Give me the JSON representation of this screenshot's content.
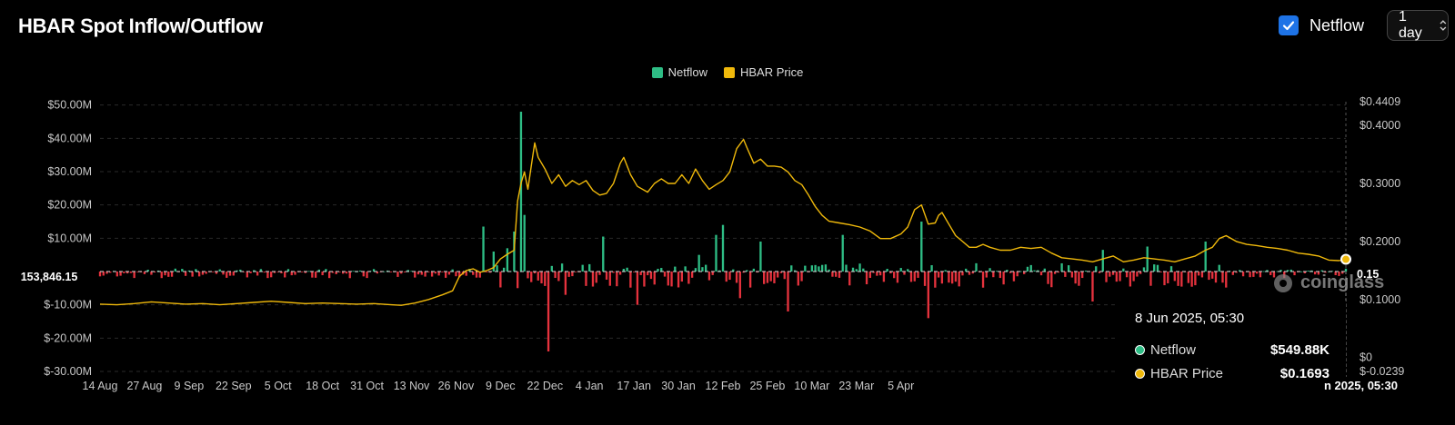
{
  "header": {
    "title": "HBAR Spot Inflow/Outflow",
    "netflow_toggle_label": "Netflow",
    "interval_value": "1 day"
  },
  "legend": [
    {
      "label": "Netflow",
      "color": "#2ebd85"
    },
    {
      "label": "HBAR Price",
      "color": "#f0b90b"
    }
  ],
  "crosshair": {
    "left_value": "153,846.15",
    "right_value": "0.15"
  },
  "watermark": "coinglass",
  "tooltip": {
    "date": "8 Jun 2025, 05:30",
    "rows": [
      {
        "name": "Netflow",
        "value": "$549.88K",
        "color": "#2ebd85"
      },
      {
        "name": "HBAR Price",
        "value": "$0.1693",
        "color": "#f0b90b"
      }
    ]
  },
  "bottom_time_label": "n 2025, 05:30",
  "colors": {
    "positive": "#2ebd85",
    "negative": "#e5323d",
    "price": "#f0b90b",
    "grid": "#2a2a2a",
    "axis_text": "#c8c8c8"
  },
  "chart_data": {
    "type": "bar",
    "title": "HBAR Spot Inflow/Outflow",
    "x_labels": [
      "14 Aug",
      "27 Aug",
      "9 Sep",
      "22 Sep",
      "5 Oct",
      "18 Oct",
      "31 Oct",
      "13 Nov",
      "26 Nov",
      "9 Dec",
      "22 Dec",
      "4 Jan",
      "17 Jan",
      "30 Jan",
      "12 Feb",
      "25 Feb",
      "10 Mar",
      "23 Mar",
      "5 Apr"
    ],
    "left_axis": {
      "ticks": [
        "$50.00M",
        "$40.00M",
        "$30.00M",
        "$20.00M",
        "$10.00M",
        "$-10.00M",
        "$-20.00M",
        "$-30.00M"
      ],
      "tick_values": [
        50,
        40,
        30,
        20,
        10,
        -10,
        -20,
        -30
      ],
      "unit": "$M",
      "ylim": [
        -30,
        51
      ]
    },
    "right_axis": {
      "ticks": [
        "$0.4409",
        "$0.4000",
        "$0.3000",
        "$0.2000",
        "$0.1000",
        "$0",
        "$-0.0239"
      ],
      "tick_values": [
        0.4409,
        0.4,
        0.3,
        0.2,
        0.1,
        0,
        -0.0239
      ],
      "ylim": [
        -0.0239,
        0.4409
      ]
    },
    "netflow_spikes": [
      {
        "day": 112,
        "value": 13.5
      },
      {
        "day": 115,
        "value": 6
      },
      {
        "day": 119,
        "value": 7
      },
      {
        "day": 121,
        "value": 12
      },
      {
        "day": 123,
        "value": 48
      },
      {
        "day": 124,
        "value": 17
      },
      {
        "day": 131,
        "value": -24
      },
      {
        "day": 136,
        "value": -7
      },
      {
        "day": 147,
        "value": 10.5
      },
      {
        "day": 157,
        "value": -10
      },
      {
        "day": 175,
        "value": 5
      },
      {
        "day": 180,
        "value": 11
      },
      {
        "day": 182,
        "value": 14
      },
      {
        "day": 187,
        "value": -8
      },
      {
        "day": 193,
        "value": 9
      },
      {
        "day": 201,
        "value": -12
      },
      {
        "day": 217,
        "value": 11
      },
      {
        "day": 240,
        "value": 15
      },
      {
        "day": 242,
        "value": -14
      },
      {
        "day": 290,
        "value": -9
      },
      {
        "day": 293,
        "value": 6.5
      },
      {
        "day": 306,
        "value": 7.5
      },
      {
        "day": 323,
        "value": 9
      }
    ],
    "series": [
      {
        "name": "Netflow",
        "axis": "left",
        "baseline_daily_range": [
          -2,
          1
        ],
        "points_shown": "daily"
      },
      {
        "name": "HBAR Price",
        "axis": "right",
        "points": [
          [
            0,
            0.092
          ],
          [
            5,
            0.091
          ],
          [
            10,
            0.093
          ],
          [
            15,
            0.096
          ],
          [
            20,
            0.094
          ],
          [
            25,
            0.092
          ],
          [
            30,
            0.093
          ],
          [
            35,
            0.091
          ],
          [
            40,
            0.093
          ],
          [
            45,
            0.095
          ],
          [
            50,
            0.097
          ],
          [
            55,
            0.095
          ],
          [
            60,
            0.093
          ],
          [
            65,
            0.094
          ],
          [
            70,
            0.093
          ],
          [
            75,
            0.092
          ],
          [
            80,
            0.093
          ],
          [
            85,
            0.091
          ],
          [
            88,
            0.09
          ],
          [
            92,
            0.094
          ],
          [
            96,
            0.1
          ],
          [
            100,
            0.108
          ],
          [
            103,
            0.115
          ],
          [
            105,
            0.14
          ],
          [
            107,
            0.15
          ],
          [
            109,
            0.153
          ],
          [
            111,
            0.147
          ],
          [
            113,
            0.15
          ],
          [
            115,
            0.155
          ],
          [
            117,
            0.17
          ],
          [
            119,
            0.178
          ],
          [
            121,
            0.185
          ],
          [
            122,
            0.27
          ],
          [
            123,
            0.3
          ],
          [
            124,
            0.32
          ],
          [
            125,
            0.29
          ],
          [
            126,
            0.33
          ],
          [
            127,
            0.37
          ],
          [
            128,
            0.345
          ],
          [
            130,
            0.325
          ],
          [
            132,
            0.3
          ],
          [
            134,
            0.315
          ],
          [
            136,
            0.295
          ],
          [
            138,
            0.305
          ],
          [
            140,
            0.298
          ],
          [
            142,
            0.305
          ],
          [
            144,
            0.288
          ],
          [
            146,
            0.28
          ],
          [
            148,
            0.283
          ],
          [
            150,
            0.3
          ],
          [
            152,
            0.335
          ],
          [
            153,
            0.345
          ],
          [
            155,
            0.315
          ],
          [
            157,
            0.295
          ],
          [
            160,
            0.285
          ],
          [
            162,
            0.3
          ],
          [
            164,
            0.308
          ],
          [
            166,
            0.3
          ],
          [
            168,
            0.3
          ],
          [
            170,
            0.315
          ],
          [
            172,
            0.3
          ],
          [
            174,
            0.325
          ],
          [
            176,
            0.305
          ],
          [
            178,
            0.29
          ],
          [
            180,
            0.298
          ],
          [
            182,
            0.305
          ],
          [
            184,
            0.32
          ],
          [
            186,
            0.36
          ],
          [
            188,
            0.376
          ],
          [
            189,
            0.362
          ],
          [
            191,
            0.335
          ],
          [
            193,
            0.342
          ],
          [
            195,
            0.33
          ],
          [
            197,
            0.33
          ],
          [
            199,
            0.328
          ],
          [
            201,
            0.32
          ],
          [
            203,
            0.305
          ],
          [
            205,
            0.298
          ],
          [
            207,
            0.28
          ],
          [
            209,
            0.26
          ],
          [
            211,
            0.245
          ],
          [
            213,
            0.235
          ],
          [
            216,
            0.232
          ],
          [
            219,
            0.229
          ],
          [
            222,
            0.225
          ],
          [
            225,
            0.218
          ],
          [
            228,
            0.205
          ],
          [
            231,
            0.205
          ],
          [
            234,
            0.213
          ],
          [
            236,
            0.225
          ],
          [
            238,
            0.255
          ],
          [
            240,
            0.263
          ],
          [
            242,
            0.23
          ],
          [
            244,
            0.232
          ],
          [
            245,
            0.245
          ],
          [
            246,
            0.25
          ],
          [
            248,
            0.23
          ],
          [
            250,
            0.21
          ],
          [
            252,
            0.2
          ],
          [
            254,
            0.19
          ],
          [
            256,
            0.19
          ],
          [
            258,
            0.195
          ],
          [
            260,
            0.19
          ],
          [
            263,
            0.185
          ],
          [
            266,
            0.185
          ],
          [
            269,
            0.19
          ],
          [
            272,
            0.188
          ],
          [
            275,
            0.19
          ],
          [
            278,
            0.18
          ],
          [
            281,
            0.172
          ],
          [
            284,
            0.17
          ],
          [
            287,
            0.168
          ],
          [
            290,
            0.165
          ],
          [
            293,
            0.17
          ],
          [
            296,
            0.175
          ],
          [
            299,
            0.165
          ],
          [
            302,
            0.168
          ],
          [
            305,
            0.172
          ],
          [
            308,
            0.17
          ],
          [
            311,
            0.168
          ],
          [
            314,
            0.165
          ],
          [
            317,
            0.17
          ],
          [
            320,
            0.175
          ],
          [
            323,
            0.185
          ],
          [
            325,
            0.19
          ],
          [
            327,
            0.205
          ],
          [
            329,
            0.21
          ],
          [
            332,
            0.2
          ],
          [
            335,
            0.195
          ],
          [
            338,
            0.193
          ],
          [
            341,
            0.19
          ],
          [
            344,
            0.188
          ],
          [
            347,
            0.185
          ],
          [
            350,
            0.18
          ],
          [
            353,
            0.178
          ],
          [
            356,
            0.175
          ],
          [
            359,
            0.168
          ],
          [
            362,
            0.167
          ],
          [
            364,
            0.1693
          ]
        ]
      }
    ],
    "day_count": 365,
    "first_day_label": "14 Aug",
    "grid": true,
    "legend_position": "top-center"
  }
}
